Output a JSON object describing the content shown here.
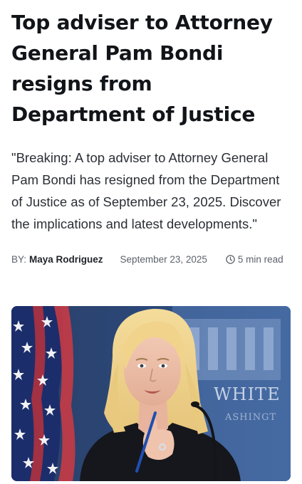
{
  "article": {
    "headline": "Top adviser to Attorney General Pam Bondi resigns from Department of Justice",
    "summary": "\"Breaking: A top adviser to Attorney General Pam Bondi has resigned from the Department of Justice as of September 23, 2025. Discover the implications and latest developments.\"",
    "byline_label": "BY:",
    "author": "Maya Rodriguez",
    "date": "September 23, 2025",
    "read_time": "5 min read",
    "read_time_icon": "clock-icon"
  },
  "hero_image": {
    "sign_text_line1": "WHITE",
    "sign_text_line2": "ASHINGT"
  }
}
